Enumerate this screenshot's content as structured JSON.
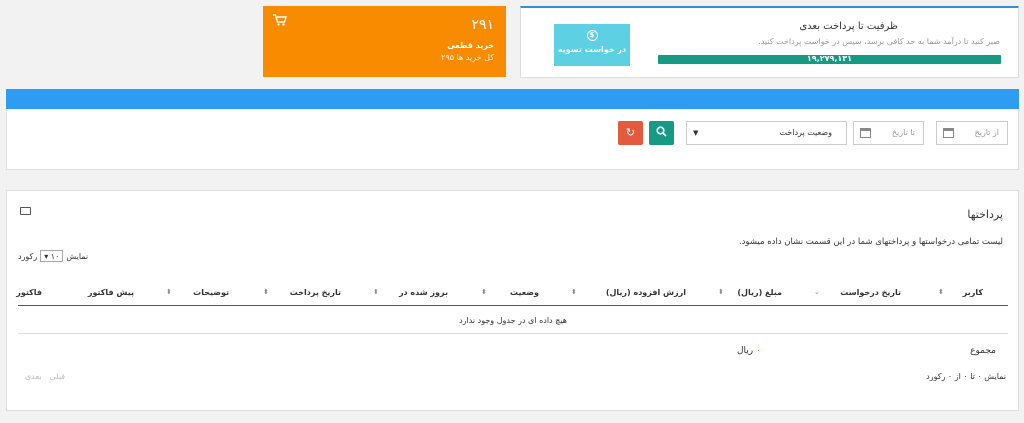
{
  "capacity": {
    "title": "ظرفیت تا پرداخت بعدی",
    "subtitle": "صبر کنید تا درآمد شما به حد کافی برسد، سپس در خواست پرداخت کنید.",
    "amount": "۱۹,۲۷۹,۱۳۱",
    "progress": 1.0,
    "settle_label": "در خواست تسویه",
    "settle_icon": "dollar-circle-icon"
  },
  "purchase": {
    "count": "۲۹۱",
    "label": "خرید قطعی",
    "total": "کل خرید ها ۲۹۵",
    "icon": "cart-icon"
  },
  "filters": {
    "from_date_placeholder": "از تاریخ",
    "to_date_placeholder": "تا تاریخ",
    "status_value": "وضعیت پرداخت",
    "search_icon": "search-icon",
    "reset_icon": "refresh-icon"
  },
  "payments": {
    "title": "پرداختها",
    "description": "لیست تمامی درخواستها و پرداختهای شما در این قسمت نشان داده میشود.",
    "show_label": "نمایش",
    "page_length": "۱۰",
    "records_label": "رکورد",
    "columns": [
      "کاربر",
      "تاریخ درخواست",
      "مبلغ (ریال)",
      "ارزش افزوده (ریال)",
      "وضعیت",
      "بروز شده در",
      "تاریخ پرداخت",
      "توضیحات",
      "پیش فاکتور",
      "فاکتور"
    ],
    "empty_message": "هیچ داده ای در جدول وجود ندارد",
    "sum_label": "مجموع",
    "sum_value": "۰",
    "sum_currency": "ریال",
    "info": "نمایش ۰ تا ۰ از ۰ رکورد",
    "prev_label": "قبلی",
    "next_label": "بعدی"
  },
  "colors": {
    "primary_blue": "#2e9cf3",
    "orange": "#f98b00",
    "teal": "#169a84",
    "cyan": "#5dd0e3",
    "danger": "#e35b3f"
  }
}
